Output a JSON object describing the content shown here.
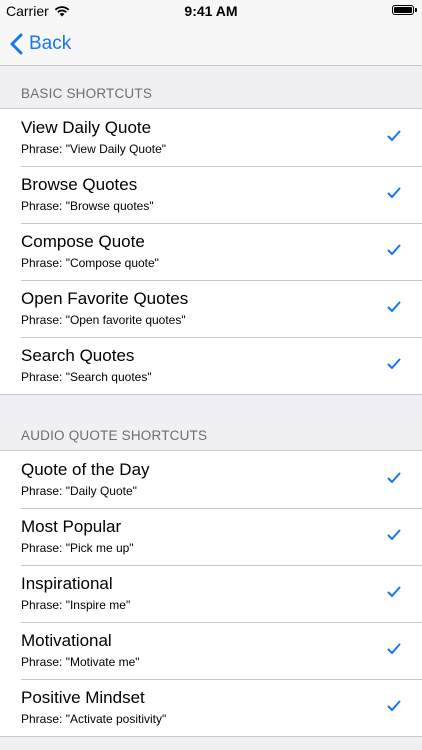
{
  "status_bar": {
    "carrier": "Carrier",
    "time": "9:41 AM"
  },
  "nav": {
    "back_label": "Back"
  },
  "colors": {
    "accent": "#1476f5",
    "group_background": "#efeff4",
    "separator": "#c8c7cc",
    "section_header_text": "#6d6d72"
  },
  "sections": [
    {
      "header": "BASIC SHORTCUTS",
      "rows": [
        {
          "title": "View Daily Quote",
          "phrase": "Phrase: \"View Daily Quote\"",
          "checked": true
        },
        {
          "title": "Browse Quotes",
          "phrase": "Phrase: \"Browse quotes\"",
          "checked": true
        },
        {
          "title": "Compose Quote",
          "phrase": "Phrase: \"Compose quote\"",
          "checked": true
        },
        {
          "title": "Open Favorite Quotes",
          "phrase": "Phrase: \"Open favorite quotes\"",
          "checked": true
        },
        {
          "title": "Search Quotes",
          "phrase": "Phrase: \"Search quotes\"",
          "checked": true
        }
      ]
    },
    {
      "header": "AUDIO QUOTE SHORTCUTS",
      "rows": [
        {
          "title": "Quote of the Day",
          "phrase": "Phrase: \"Daily Quote\"",
          "checked": true
        },
        {
          "title": "Most Popular",
          "phrase": "Phrase: \"Pick me up\"",
          "checked": true
        },
        {
          "title": "Inspirational",
          "phrase": "Phrase: \"Inspire me\"",
          "checked": true
        },
        {
          "title": "Motivational",
          "phrase": "Phrase: \"Motivate me\"",
          "checked": true
        },
        {
          "title": "Positive Mindset",
          "phrase": "Phrase: \"Activate positivity\"",
          "checked": true
        }
      ]
    }
  ]
}
